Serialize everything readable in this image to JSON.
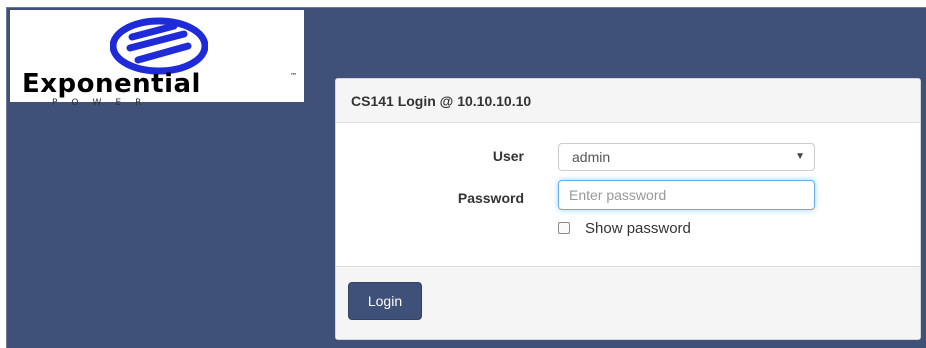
{
  "brand": {
    "name": "Exponential",
    "trademark": "™",
    "tagline": "POWER",
    "logo_colors": {
      "mark": "#1f2bd8",
      "text": "#000000"
    }
  },
  "colors": {
    "page_background": "#3f5079",
    "panel_header_bg": "#f5f5f5",
    "primary_button": "#3f5079",
    "focus_border": "#66afe9"
  },
  "login": {
    "title": "CS141 Login @ 10.10.10.10",
    "user_label": "User",
    "user_value": "admin",
    "user_options_visible": [
      "admin"
    ],
    "password_label": "Password",
    "password_placeholder": "Enter password",
    "password_value": "",
    "show_password_label": "Show password",
    "show_password_checked": false,
    "submit_label": "Login"
  },
  "icons": {
    "dropdown": "chevron-down-icon",
    "logo": "exponential-power-logo"
  }
}
